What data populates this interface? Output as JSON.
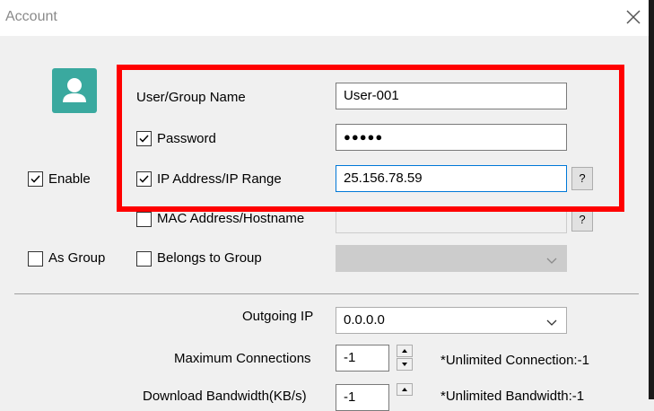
{
  "window": {
    "title": "Account"
  },
  "form": {
    "user_group_name_label": "User/Group Name",
    "user_group_name_value": "User-001",
    "password_label": "Password",
    "password_value": "●●●●●",
    "password_checked": true,
    "ip_label": "IP Address/IP Range",
    "ip_value": "25.156.78.59",
    "ip_checked": true,
    "mac_label": "MAC Address/Hostname",
    "mac_checked": false,
    "mac_value": "",
    "enable_label": "Enable",
    "enable_checked": true,
    "as_group_label": "As Group",
    "as_group_checked": false,
    "belongs_label": "Belongs to Group",
    "belongs_checked": false,
    "help_label": "?"
  },
  "settings": {
    "outgoing_ip_label": "Outgoing IP",
    "outgoing_ip_value": "0.0.0.0",
    "max_conn_label": "Maximum Connections",
    "max_conn_value": "-1",
    "max_conn_note": "*Unlimited Connection:-1",
    "download_label": "Download Bandwidth(KB/s)",
    "download_value": "-1",
    "download_note": "*Unlimited Bandwidth:-1"
  },
  "colors": {
    "highlight": "#ff0000",
    "avatar": "#3aa99f",
    "focus": "#0078d7"
  }
}
